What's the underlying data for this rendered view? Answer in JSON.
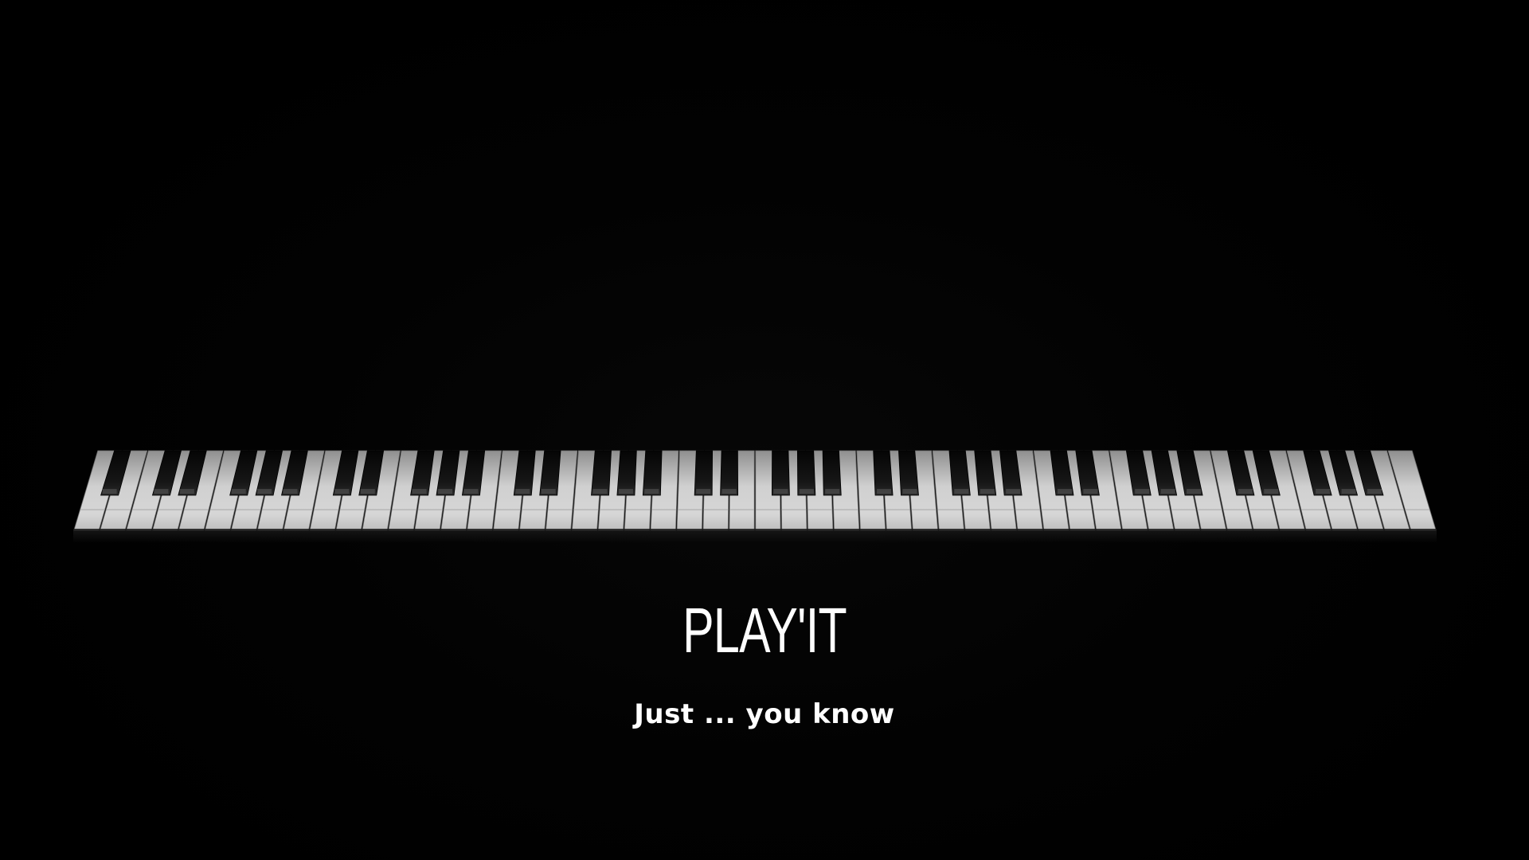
{
  "hero": {
    "title": "PLAY'IT",
    "subtitle": "Just ... you know"
  },
  "keyboard": {
    "white_keys": 52,
    "black_keys": 36,
    "white_key_color": "#d9d9d9",
    "black_key_color": "#111111",
    "background_color": "#000000"
  }
}
